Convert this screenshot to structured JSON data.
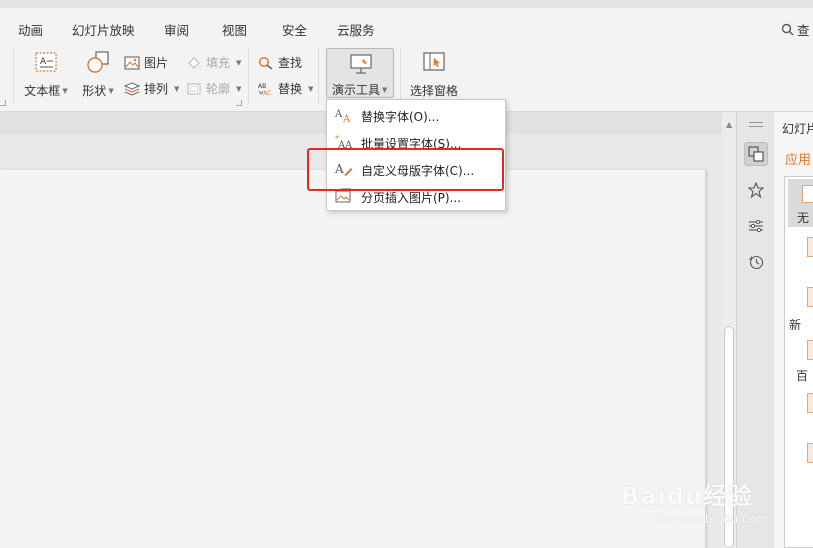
{
  "ribbon_tabs": [
    "动画",
    "幻灯片放映",
    "审阅",
    "视图",
    "安全",
    "云服务"
  ],
  "search_tab": "查",
  "toolbar": {
    "textbox_label": "文本框",
    "shape_label": "形状",
    "picture_label": "图片",
    "fill_label": "填充",
    "arrange_label": "排列",
    "outline_label": "轮廓",
    "find_label": "查找",
    "replace_label": "替换",
    "demo_tools_label": "演示工具",
    "selection_pane_label": "选择窗格"
  },
  "dropdown": {
    "items": [
      {
        "label": "替换字体(O)..."
      },
      {
        "label": "批量设置字体(S)..."
      },
      {
        "label": "自定义母版字体(C)..."
      },
      {
        "label": "分页插入图片(P)..."
      }
    ]
  },
  "right_panel": {
    "title": "幻灯片",
    "tab": "应用",
    "item_first": "无",
    "text_new": "新",
    "text_bai": "百"
  },
  "watermark": {
    "brand": "Baidu经验",
    "url": "jingyan.baidu.com"
  },
  "colors": {
    "accent": "#e07a2f",
    "highlight": "#e8281e",
    "ribbon_bg": "#f3f3f3"
  },
  "icons": [
    "textbox-icon",
    "shape-icon",
    "picture-icon",
    "fill-icon",
    "arrange-icon",
    "outline-icon",
    "find-icon",
    "replace-icon",
    "demo-tools-icon",
    "selection-pane-icon",
    "font-replace-icon",
    "batch-font-icon",
    "master-font-icon",
    "insert-picture-icon",
    "search-icon"
  ]
}
